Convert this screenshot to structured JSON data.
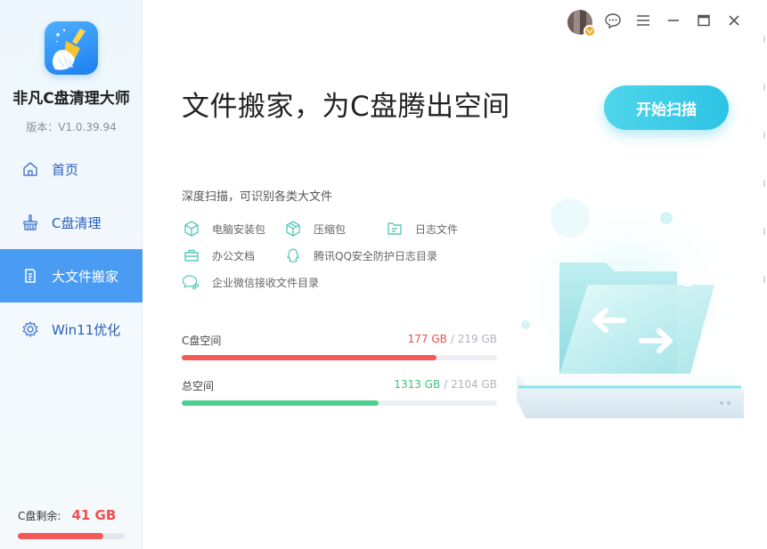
{
  "app": {
    "name": "非凡C盘清理大师",
    "version": "版本：V1.0.39.94"
  },
  "sidebar": {
    "items": [
      {
        "label": "首页",
        "icon": "home-icon",
        "active": false
      },
      {
        "label": "C盘清理",
        "icon": "broom-icon",
        "active": false
      },
      {
        "label": "大文件搬家",
        "icon": "document-icon",
        "active": true
      },
      {
        "label": "Win11优化",
        "icon": "gear-icon",
        "active": false
      }
    ],
    "disk": {
      "label": "C盘剩余:",
      "value": "41 GB",
      "fraction_used": 0.8
    }
  },
  "titlebar": {
    "icons": [
      "avatar",
      "chat-icon",
      "menu-icon",
      "minimize-icon",
      "maximize-icon",
      "close-icon"
    ]
  },
  "main": {
    "headline": "文件搬家，为C盘腾出空间",
    "scan_button": "开始扫描",
    "subtitle": "深度扫描，可识别各类大文件",
    "file_types": [
      {
        "label": "电脑安装包",
        "icon": "package-icon"
      },
      {
        "label": "压缩包",
        "icon": "archive-icon"
      },
      {
        "label": "日志文件",
        "icon": "log-file-icon"
      },
      {
        "label": "办公文档",
        "icon": "briefcase-icon"
      },
      {
        "label": "腾讯QQ安全防护日志目录",
        "icon": "qq-icon"
      },
      {
        "label": "企业微信接收文件目录",
        "icon": "wecom-icon"
      }
    ],
    "c_disk": {
      "label": "C盘空间",
      "used": "177 GB",
      "total": "/ 219 GB",
      "fraction": 0.808,
      "color": "#f25a5a"
    },
    "all_disk": {
      "label": "总空间",
      "used": "1313 GB",
      "total": "/ 2104 GB",
      "fraction": 0.624,
      "color": "#4cd08e"
    }
  },
  "colors": {
    "accent": "#4a9cf3",
    "scan_button": "#3ccfe8",
    "danger": "#f25a5a",
    "success": "#4cd08e"
  }
}
